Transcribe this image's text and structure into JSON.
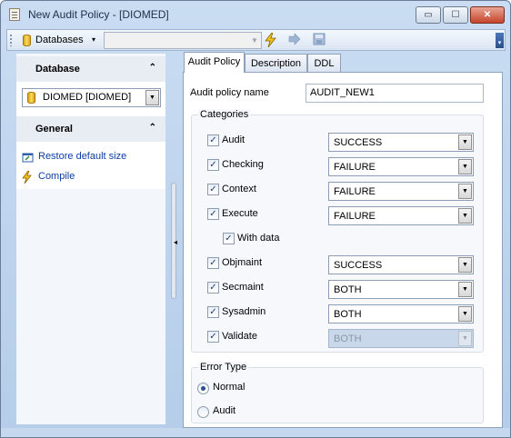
{
  "window": {
    "title": "New Audit Policy - [DIOMED]"
  },
  "window_buttons": {
    "minimize": "▭",
    "maximize": "☐",
    "close": "✕"
  },
  "toolbar": {
    "databases_label": "Databases",
    "databases_arrow": "▾",
    "combo_value": "",
    "combo_arrow": "▼"
  },
  "sidebar": {
    "database": {
      "title": "Database",
      "collapse": "⌃",
      "selected": "DIOMED [DIOMED]",
      "arrow": "▼"
    },
    "general": {
      "title": "General",
      "collapse": "⌃",
      "links": [
        {
          "label": "Restore default size",
          "icon": "restore-size-icon"
        },
        {
          "label": "Compile",
          "icon": "lightning-icon"
        }
      ]
    }
  },
  "tabs": [
    {
      "label": "Audit Policy",
      "active": true
    },
    {
      "label": "Description",
      "active": false
    },
    {
      "label": "DDL",
      "active": false
    }
  ],
  "form": {
    "policy_name_label": "Audit policy name",
    "policy_name_value": "AUDIT_NEW1",
    "categories_title": "Categories",
    "categories": [
      {
        "label": "Audit",
        "checked": true,
        "value": "SUCCESS",
        "enabled": true
      },
      {
        "label": "Checking",
        "checked": true,
        "value": "FAILURE",
        "enabled": true
      },
      {
        "label": "Context",
        "checked": true,
        "value": "FAILURE",
        "enabled": true
      },
      {
        "label": "Execute",
        "checked": true,
        "value": "FAILURE",
        "enabled": true
      },
      {
        "label": "Objmaint",
        "checked": true,
        "value": "SUCCESS",
        "enabled": true
      },
      {
        "label": "Secmaint",
        "checked": true,
        "value": "BOTH",
        "enabled": true
      },
      {
        "label": "Sysadmin",
        "checked": true,
        "value": "BOTH",
        "enabled": true
      },
      {
        "label": "Validate",
        "checked": true,
        "value": "BOTH",
        "enabled": false
      }
    ],
    "with_data": {
      "label": "With data",
      "checked": true
    },
    "check_mark": "✓",
    "select_arrow": "▼",
    "error_type_title": "Error Type",
    "error_types": [
      {
        "label": "Normal",
        "selected": true
      },
      {
        "label": "Audit",
        "selected": false
      }
    ]
  },
  "colors": {
    "accent": "#0d3ca4",
    "frame": "#b5cde9"
  }
}
